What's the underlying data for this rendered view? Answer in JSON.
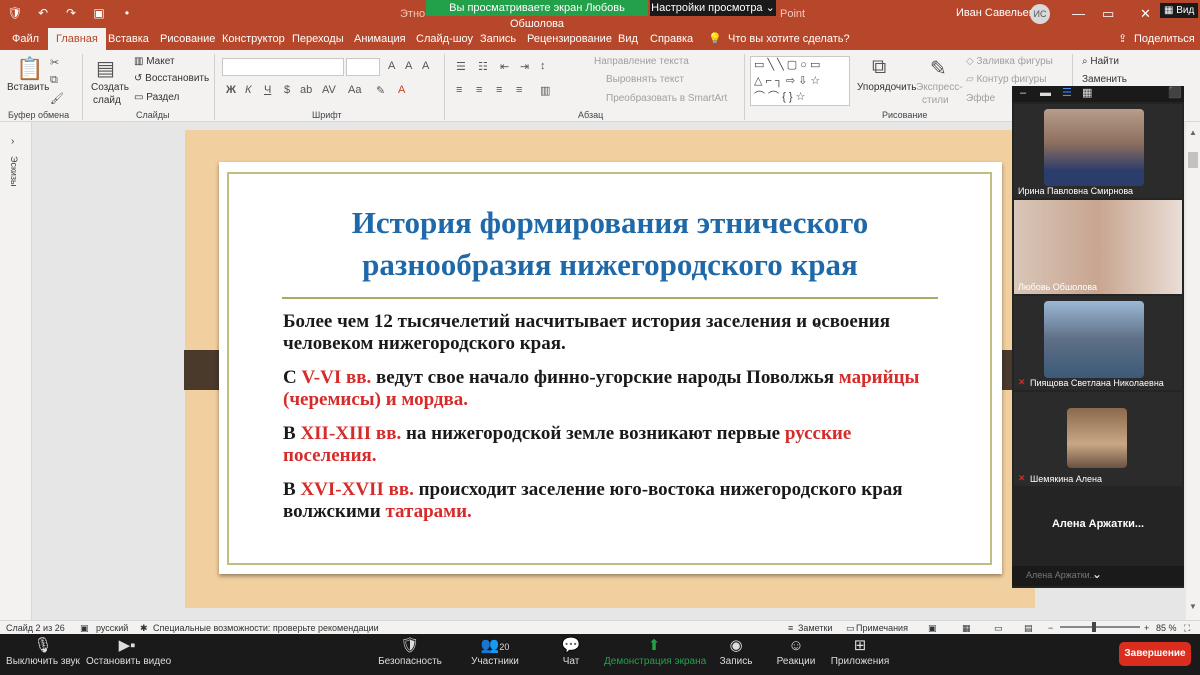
{
  "titlebar": {
    "share_banner": "Вы просматриваете экран Любовь Обшолова",
    "view_options": "Настройки просмотра ⌄",
    "doc_title_left": "Этно",
    "doc_title_right": "Point",
    "user_name": "Иван Савельев",
    "user_initials": "ИС",
    "view_label": "Вид"
  },
  "tabs": [
    "Файл",
    "Главная",
    "Вставка",
    "Рисование",
    "Конструктор",
    "Переходы",
    "Анимация",
    "Слайд-шоу",
    "Запись",
    "Рецензирование",
    "Вид",
    "Справка"
  ],
  "tell_me": "Что вы хотите сделать?",
  "share_button": "Поделиться",
  "ribbon": {
    "paste": "Вставить",
    "clipboard_group": "Буфер обмена",
    "create_slide": "Создать",
    "create_slide2": "слайд",
    "layout": "Макет",
    "reset": "Восстановить",
    "section": "Раздел",
    "slides_group": "Слайды",
    "font_group": "Шрифт",
    "text_direction": "Направление текста",
    "align_text": "Выровнять текст",
    "convert_smartart": "Преобразовать в SmartArt",
    "paragraph_group": "Абзац",
    "arrange": "Упорядочить",
    "quick_styles": "Экспресс-",
    "quick_styles2": "стили",
    "shape_fill": "Заливка фигуры",
    "shape_outline": "Контур фигуры",
    "effects": "Эффе",
    "drawing_group": "Рисование",
    "find": "Найти",
    "replace": "Заменить"
  },
  "sidepanel": {
    "label": "Эскизы"
  },
  "slide": {
    "title_line1": "История формирования этнического",
    "title_line2": "разнообразия нижегородского края",
    "p1": "Более чем 12 тысячелетий насчитывает история заселения и освоения человеком нижегородского края.",
    "p2_a": "С ",
    "p2_b": "V-VI вв.",
    "p2_c": " ведут свое начало финно-угорские народы Поволжья ",
    "p2_d": "марийцы (черемисы) и мордва.",
    "p3_a": "В ",
    "p3_b": "XII-XIII вв.",
    "p3_c": " на нижегородской земле возникают первые ",
    "p3_d": "русские поселения.",
    "p4_a": "В ",
    "p4_b": "XVI-XVII вв.",
    "p4_c": " происходит заселение юго-востока нижегородского края волжскими ",
    "p4_d": "татарами."
  },
  "status": {
    "slide_of": "Слайд 2 из 26",
    "language": "русский",
    "accessibility": "Специальные возможности: проверьте рекомендации",
    "notes": "Заметки",
    "comments": "Примечания",
    "zoom": "85 %"
  },
  "participants_panel": {
    "tiles": [
      {
        "name": "Ирина Павловна Смирнова",
        "muted": false
      },
      {
        "name": "Любовь Обшолова",
        "muted": false
      },
      {
        "name": "Пиящова Светлана Николаевна",
        "muted": true
      },
      {
        "name": "Шемякина Алена",
        "muted": true
      }
    ],
    "tile5_name": "Алена Аржатки...",
    "bottom_name": "Алена Аржатки..."
  },
  "zoombar": {
    "mute": "Выключить звук",
    "stop_video": "Остановить видео",
    "security": "Безопасность",
    "participants": "Участники",
    "participants_count": "20",
    "chat": "Чат",
    "share_screen": "Демонстрация экрана",
    "record": "Запись",
    "reactions": "Реакции",
    "apps": "Приложения",
    "end": "Завершение"
  },
  "colors": {
    "ppt_accent": "#b7472a",
    "slide_title": "#2069a8",
    "highlight_red": "#d62b2b",
    "zoom_share_green": "#23a04a",
    "zoom_end_red": "#d92d20"
  }
}
